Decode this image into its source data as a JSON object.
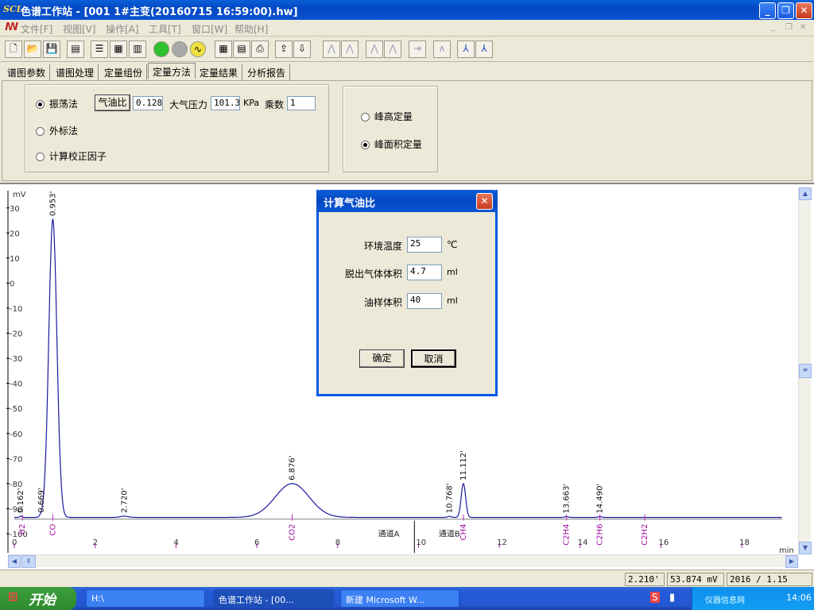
{
  "window": {
    "logo": "SCL",
    "title": "色谱工作站 - [001 1#主变(20160715 16:59:00).hw]",
    "minimize": "_",
    "restore": "❐",
    "close": "✕"
  },
  "menu": {
    "items": [
      "文件[F]",
      "视图[V]",
      "操作[A]",
      "工具[T]",
      "窗口[W]",
      "帮助[H]"
    ],
    "mdi_buttons": [
      "_",
      "❐",
      "✕"
    ]
  },
  "tabs": [
    "谱图参数",
    "谱图处理",
    "定量组份",
    "定量方法",
    "定量结果",
    "分析报告"
  ],
  "active_tab": "定量方法",
  "method": {
    "options": [
      "振荡法",
      "外标法",
      "计算校正因子"
    ],
    "selected": "振荡法",
    "gas_oil_button": "气油比",
    "gas_oil_value": "0.128",
    "pressure_label": "大气压力",
    "pressure_value": "101.3",
    "pressure_unit": "KPa",
    "multiplier_label": "乘数",
    "multiplier_value": "1"
  },
  "quant_type": {
    "options": [
      "峰高定量",
      "峰面积定量"
    ],
    "selected": "峰面积定量"
  },
  "chart_data": {
    "type": "line",
    "ylabel": "mV",
    "xlabel": "min",
    "xlim": [
      0,
      19
    ],
    "ylim": [
      -100,
      35
    ],
    "x_ticks": [
      0,
      2,
      4,
      6,
      8,
      10,
      12,
      14,
      16,
      18
    ],
    "y_ticks": [
      30,
      20,
      10,
      0,
      -10,
      -20,
      -30,
      -40,
      -50,
      -60,
      -70,
      -80,
      -90,
      -100
    ],
    "y_tick_labels": [
      "30",
      "20",
      "10",
      "0",
      "-10",
      "-20",
      "-30",
      "-40",
      "-50",
      "-60",
      "-70",
      "-80",
      "-90",
      "-100"
    ],
    "baseline": -93.5,
    "peaks": [
      {
        "time": 0.162,
        "label": "0.162'",
        "height": 0.5,
        "width": 0.03
      },
      {
        "time": 0.669,
        "label": "0.669'",
        "height": 0.6,
        "width": 0.04
      },
      {
        "time": 0.953,
        "label": "0.953'",
        "height": 119,
        "width": 0.1
      },
      {
        "time": 2.72,
        "label": "2.720'",
        "height": 0.5,
        "width": 0.1
      },
      {
        "time": 6.876,
        "label": "6.876'",
        "height": 13.5,
        "width": 0.42
      },
      {
        "time": 10.768,
        "label": "10.768'",
        "height": 0.4,
        "width": 0.05
      },
      {
        "time": 11.112,
        "label": "11.112'",
        "height": 13.5,
        "width": 0.055
      },
      {
        "time": 13.663,
        "label": "13.663'",
        "height": 0.3,
        "width": 0.05
      },
      {
        "time": 14.49,
        "label": "14.490'",
        "height": 0.3,
        "width": 0.05
      }
    ],
    "components": [
      {
        "name": "H2",
        "time": 0.2
      },
      {
        "name": "CO",
        "time": 0.953
      },
      {
        "name": "CO2",
        "time": 6.876
      },
      {
        "name": "CH4",
        "time": 11.112
      },
      {
        "name": "C2H4",
        "time": 13.663
      },
      {
        "name": "C2H6",
        "time": 14.49
      },
      {
        "name": "C2H2",
        "time": 15.6
      }
    ],
    "channels": [
      {
        "label": "通道A",
        "time": 9.0
      },
      {
        "label": "通道B",
        "time": 10.5
      }
    ],
    "channel_divider": 9.9
  },
  "dialog": {
    "title": "计算气油比",
    "fields": [
      {
        "label": "环境温度",
        "value": "25",
        "unit": "℃"
      },
      {
        "label": "脱出气体体积",
        "value": "4.7",
        "unit": "ml"
      },
      {
        "label": "油样体积",
        "value": "40",
        "unit": "ml"
      }
    ],
    "ok": "确定",
    "cancel": "取消"
  },
  "status": [
    "2.210'",
    "53.874 mV",
    "2016 / 1.15"
  ],
  "taskbar": {
    "start": "开始",
    "tasks": [
      "H:\\",
      "色谱工作站 - [00...",
      "新建 Microsoft W..."
    ],
    "time": "14:06",
    "watermark": "仪器信息网"
  }
}
